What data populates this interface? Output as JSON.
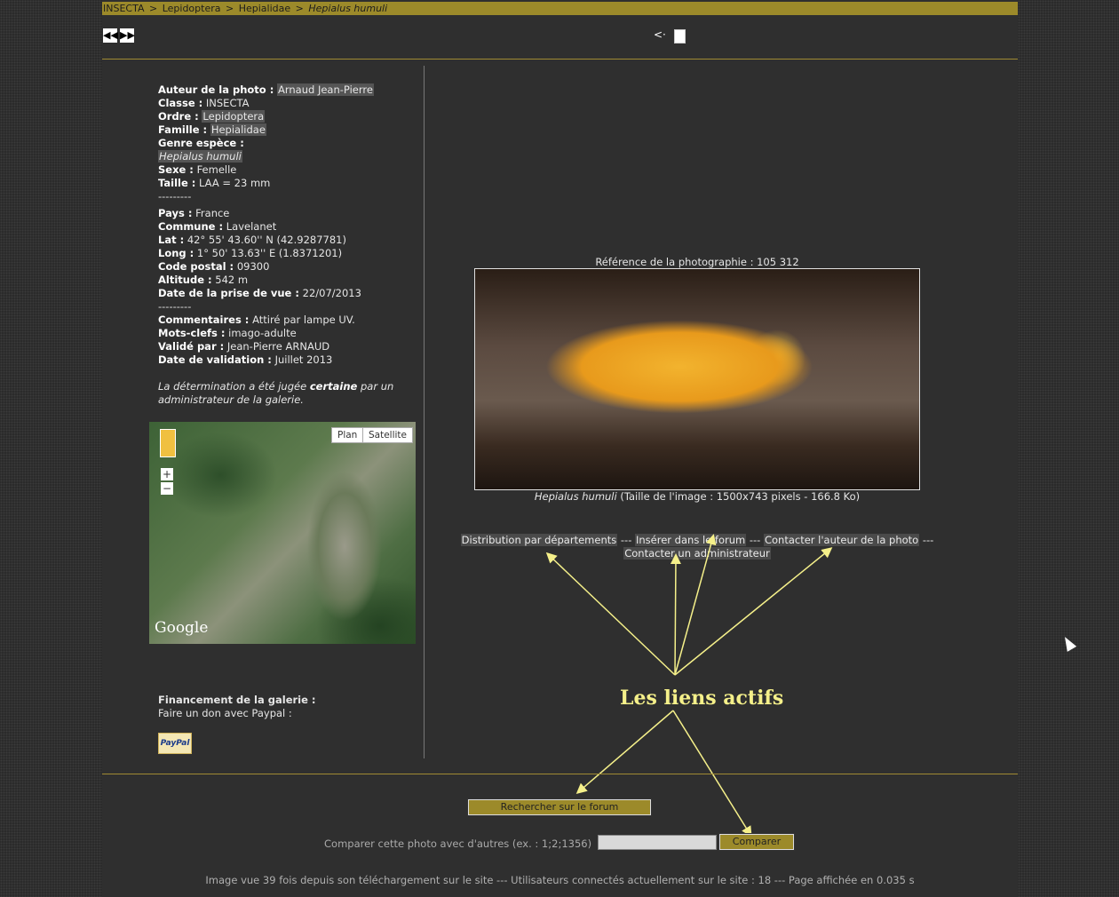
{
  "breadcrumb": {
    "items": [
      "INSECTA",
      ">",
      "Lepidoptera",
      ">",
      "Hepialidae",
      ">"
    ],
    "species": "Hepialus humuli"
  },
  "nav": {
    "prev": "◀◀",
    "next": "▶▶",
    "back": "<·",
    "doc": "▯"
  },
  "info": {
    "author_label": "Auteur de la photo :",
    "author": "Arnaud Jean-Pierre",
    "classe_label": "Classe :",
    "classe": "INSECTA",
    "ordre_label": "Ordre :",
    "ordre": "Lepidoptera",
    "famille_label": "Famille :",
    "famille": "Hepialidae",
    "genre_label": "Genre espèce :",
    "genre": "Hepialus humuli",
    "sexe_label": "Sexe :",
    "sexe": "Femelle",
    "taille_label": "Taille :",
    "taille": "LAA = 23 mm",
    "sep": "---------",
    "pays_label": "Pays :",
    "pays": "France",
    "commune_label": "Commune :",
    "commune": "Lavelanet",
    "lat_label": "Lat :",
    "lat": "42° 55' 43.60'' N (42.9287781)",
    "long_label": "Long :",
    "long": "1° 50' 13.63'' E (1.8371201)",
    "cp_label": "Code postal :",
    "cp": "09300",
    "alt_label": "Altitude :",
    "alt": "542 m",
    "date_label": "Date de la prise de vue :",
    "date": "22/07/2013",
    "comm_label": "Commentaires :",
    "comm": "Attiré par lampe UV.",
    "mots_label": "Mots-clefs :",
    "mots": "imago-adulte",
    "valide_label": "Validé par :",
    "valide": "Jean-Pierre ARNAUD",
    "dval_label": "Date de validation :",
    "dval": "Juillet 2013",
    "note_a": "La détermination a été jugée ",
    "note_b": "certaine",
    "note_c": " par un administrateur de la galerie."
  },
  "map": {
    "plan": "Plan",
    "satellite": "Satellite",
    "zoom_in": "+",
    "zoom_out": "−",
    "google": "Google"
  },
  "funding": {
    "title": "Financement de la galerie :",
    "text": "Faire un don avec Paypal :",
    "paypal": "PayPal"
  },
  "photo": {
    "ref": "Référence de la photographie : 105 312",
    "species": "Hepialus humuli",
    "details": " (Taille de l'image : 1500x743 pixels - 166.8 Ko)"
  },
  "links": {
    "distribution": "Distribution par départements",
    "forum": "Insérer dans le forum",
    "contact_author": "Contacter l'auteur de la photo",
    "contact_admin": "Contacter un administrateur",
    "sep": "---"
  },
  "annotation": "Les liens actifs",
  "search_button": "Rechercher sur le forum",
  "compare": {
    "label": "Comparer cette photo avec d'autres (ex. : 1;2;1356)",
    "button": "Comparer",
    "value": ""
  },
  "footer": "Image vue 39 fois depuis son téléchargement sur le site --- Utilisateurs connectés actuellement sur le site : 18 --- Page affichée en 0.035 s"
}
